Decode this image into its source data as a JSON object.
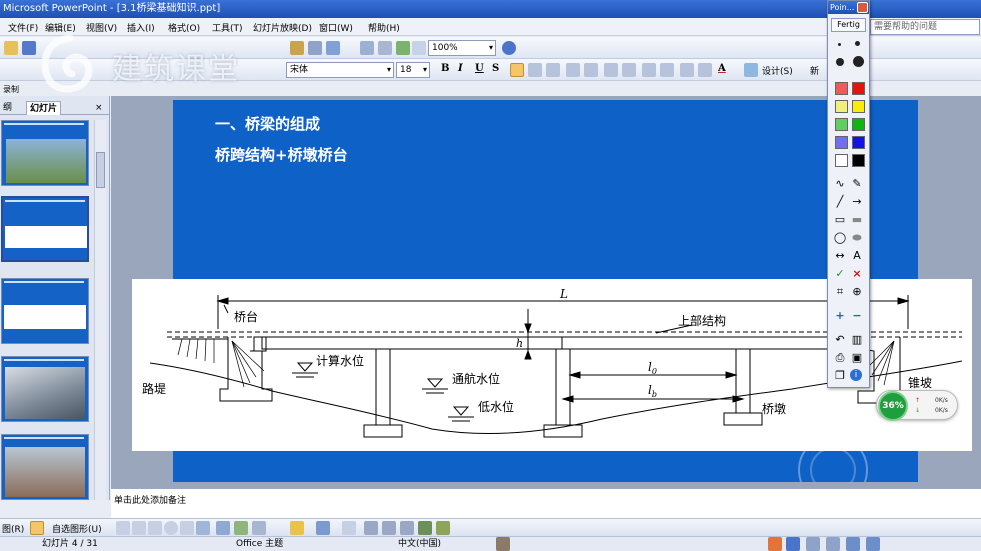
{
  "window": {
    "title": "Microsoft PowerPoint - [3.1桥梁基础知识.ppt]"
  },
  "menu": [
    "文件(F)",
    "编辑(E)",
    "视图(V)",
    "插入(I)",
    "格式(O)",
    "工具(T)",
    "幻灯片放映(D)",
    "窗口(W)",
    "帮助(H)"
  ],
  "help_search": {
    "placeholder": "需要帮助的问题"
  },
  "toolbar": {
    "zoom": "100%",
    "font_name": "宋体",
    "font_size": "18",
    "bold": "B",
    "italic": "I",
    "underline": "U",
    "shadow": "S",
    "font_color_label": "A",
    "design_label": "设计(S)",
    "new_slide_label": "新"
  },
  "watermark": {
    "text": "建筑课堂"
  },
  "left_pane": {
    "record_label": "录制",
    "tab_outline": "纲",
    "tab_slides": "幻灯片",
    "close": "×"
  },
  "slide": {
    "title1": "一、桥梁的组成",
    "title2": "桥跨结构+桥墩桥台",
    "diagram": {
      "span_label": "L",
      "abutment_label": "桥台",
      "superstructure_label": "上部结构",
      "height_label": "h",
      "design_water_label": "计算水位",
      "navigable_water_label": "通航水位",
      "low_water_label": "低水位",
      "clear_span_label": "l",
      "clear_span_sub": "0",
      "calc_span_label": "l",
      "calc_span_sub": "b",
      "embankment_label": "路堤",
      "pier_label": "桥墩",
      "cone_slope_label": "锥坡"
    }
  },
  "notes": {
    "placeholder": "单击此处添加备注"
  },
  "drawbar": {
    "draw_label": "图(R)",
    "autoshape_label": "自选图形(U)"
  },
  "status": {
    "slide_indicator": "幻灯片 4 / 31",
    "theme": "Office 主题",
    "language": "中文(中国)"
  },
  "pointer_tool": {
    "title": "Poin...",
    "done_label": "Fertig",
    "text_tool": "A",
    "delete_tool": "×",
    "info_tool": "i"
  },
  "speed_widget": {
    "percent": "36%",
    "up": "0K/s",
    "down": "0K/s"
  },
  "colors": {
    "slide_bg": "#0e61c6",
    "title_bar": "#1f4fb3",
    "speed_green": "#1f9e3e"
  }
}
